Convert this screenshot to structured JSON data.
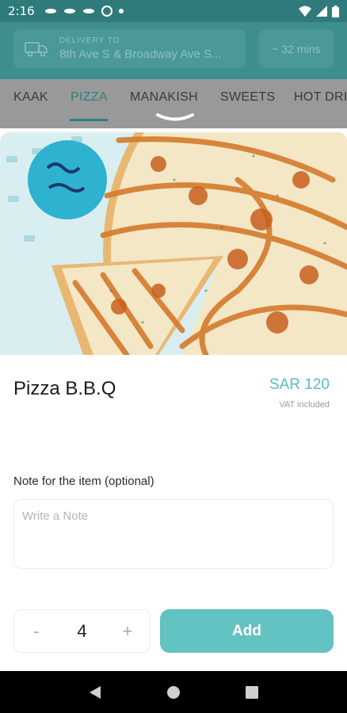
{
  "status_bar": {
    "time": "2:16"
  },
  "header": {
    "delivery_label": "DELIVERY TO",
    "delivery_address": "8th Ave S & Broadway Ave S...",
    "eta": "~ 32 mins"
  },
  "tabs": [
    {
      "label": "KAAK"
    },
    {
      "label": "PIZZA"
    },
    {
      "label": "MANAKISH"
    },
    {
      "label": "SWEETS"
    },
    {
      "label": "HOT DRI"
    }
  ],
  "item": {
    "name": "Pizza B.B.Q",
    "price": "SAR 120",
    "vat_note": "VAT included"
  },
  "note": {
    "label": "Note for the item (optional)",
    "placeholder": "Write a Note",
    "value": ""
  },
  "quantity": {
    "minus": "-",
    "value": "4",
    "plus": "+"
  },
  "add_button": {
    "label": "Add"
  },
  "colors": {
    "accent": "#5cbcbc",
    "header": "#3e8e8e",
    "add_button": "#63c2c2"
  },
  "icons": [
    "truck-icon",
    "back-nav-icon",
    "home-nav-icon",
    "recents-nav-icon",
    "wifi-icon",
    "signal-icon",
    "battery-icon"
  ]
}
